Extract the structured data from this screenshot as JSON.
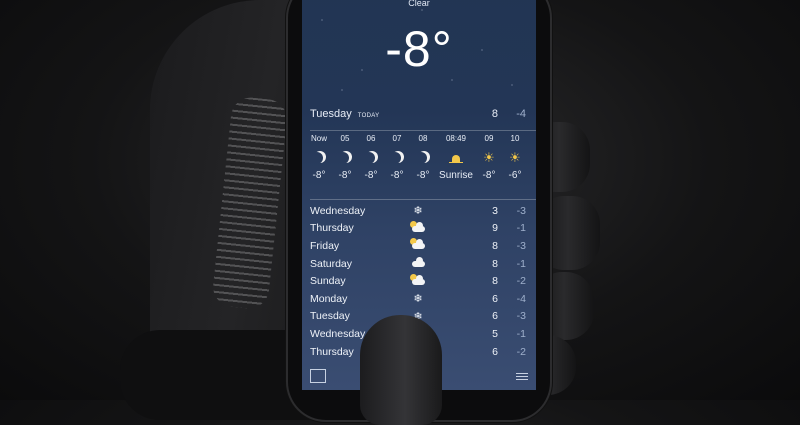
{
  "current": {
    "condition": "Clear",
    "temperature": "-8°"
  },
  "today": {
    "day": "Tuesday",
    "tag": "TODAY",
    "high": "8",
    "low": "-4"
  },
  "hourly": [
    {
      "time": "Now",
      "icon": "moon-icon",
      "temp": "-8°"
    },
    {
      "time": "05",
      "icon": "moon-icon",
      "temp": "-8°"
    },
    {
      "time": "06",
      "icon": "moon-icon",
      "temp": "-8°"
    },
    {
      "time": "07",
      "icon": "moon-icon",
      "temp": "-8°"
    },
    {
      "time": "08",
      "icon": "moon-icon",
      "temp": "-8°"
    },
    {
      "time": "08:49",
      "icon": "sunrise-icon",
      "temp": "Sunrise"
    },
    {
      "time": "09",
      "icon": "sun-icon",
      "temp": "-8°"
    },
    {
      "time": "10",
      "icon": "sun-icon",
      "temp": "-6°"
    }
  ],
  "daily": [
    {
      "day": "Wednesday",
      "icon": "snow-icon",
      "high": "3",
      "low": "-3"
    },
    {
      "day": "Thursday",
      "icon": "partly-cloudy-icon",
      "high": "9",
      "low": "-1"
    },
    {
      "day": "Friday",
      "icon": "partly-cloudy-icon",
      "high": "8",
      "low": "-3"
    },
    {
      "day": "Saturday",
      "icon": "cloud-icon",
      "high": "8",
      "low": "-1"
    },
    {
      "day": "Sunday",
      "icon": "partly-cloudy-icon",
      "high": "8",
      "low": "-2"
    },
    {
      "day": "Monday",
      "icon": "snow-icon",
      "high": "6",
      "low": "-4"
    },
    {
      "day": "Tuesday",
      "icon": "snow-icon",
      "high": "6",
      "low": "-3"
    },
    {
      "day": "Wednesday",
      "icon": "snow-icon",
      "high": "5",
      "low": "-1"
    },
    {
      "day": "Thursday",
      "icon": "snow-icon",
      "high": "6",
      "low": "-2"
    }
  ],
  "colors": {
    "sky_top": "#223553",
    "sky_bottom": "#3a4d72",
    "sun": "#f3c84a"
  }
}
